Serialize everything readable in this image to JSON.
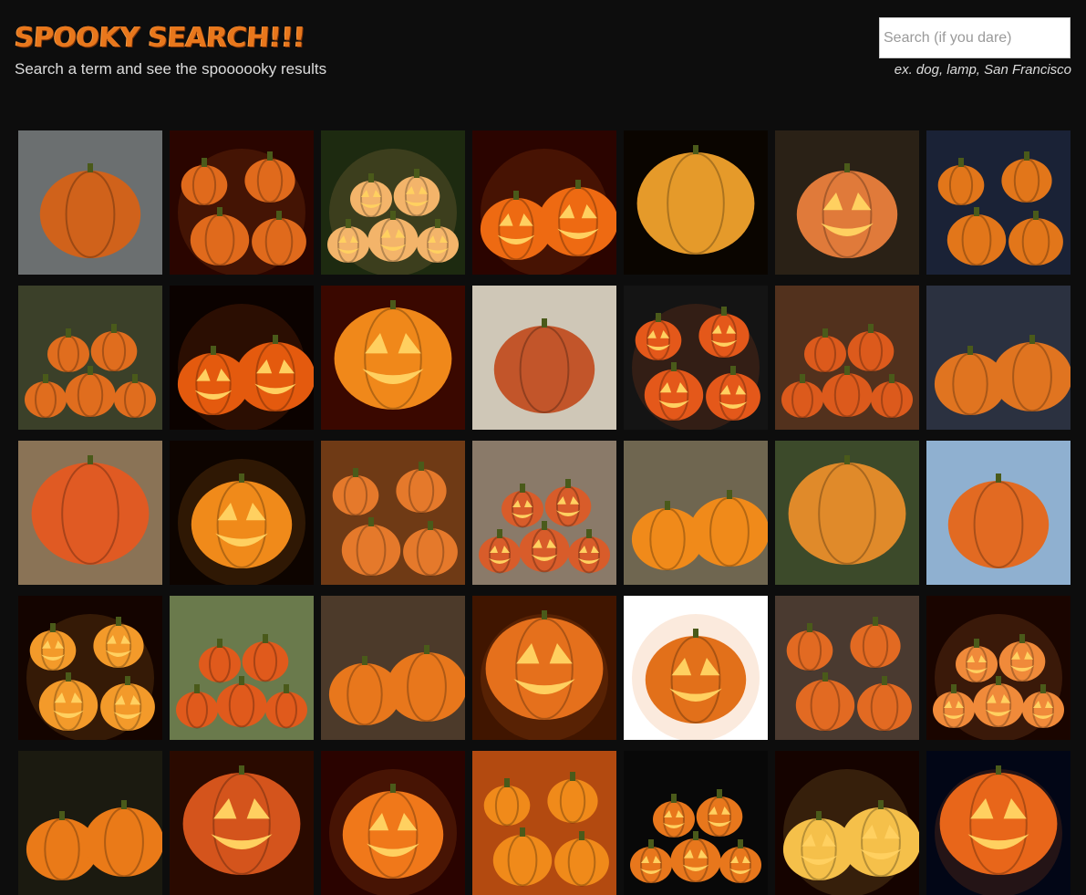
{
  "header": {
    "title": "SPOOKY SEARCH!!!",
    "subtitle": "Search a term and see the spoooooky results"
  },
  "search": {
    "placeholder": "Search (if you dare)",
    "value": "",
    "hint": "ex. dog, lamp, San Francisco"
  },
  "colors": {
    "accent": "#e8771c",
    "background": "#0d0d0d",
    "text": "#dcdcdc"
  },
  "results": [
    {
      "theme": "pumpkins-misty",
      "bg": "#6b6f70",
      "fg": "#d0621b"
    },
    {
      "theme": "pumpkins-dark-red",
      "bg": "#2a0500",
      "fg": "#e06a1c"
    },
    {
      "theme": "jack-o-lantern-pair",
      "bg": "#1d2a10",
      "fg": "#f3b46a"
    },
    {
      "theme": "jack-o-lantern-glow",
      "bg": "#2b0400",
      "fg": "#ee6a12"
    },
    {
      "theme": "small-pumpkins",
      "bg": "#0a0500",
      "fg": "#e59a2a"
    },
    {
      "theme": "carved-flag-pumpkin",
      "bg": "#2a2116",
      "fg": "#e07a3a"
    },
    {
      "theme": "skeleton-pumpkins",
      "bg": "#1a2236",
      "fg": "#e2761a"
    },
    {
      "theme": "pumpkins-pots",
      "bg": "#3b4029",
      "fg": "#e06d1e"
    },
    {
      "theme": "dark-lanterns",
      "bg": "#0b0200",
      "fg": "#e45a0e"
    },
    {
      "theme": "cat-carved-pumpkin",
      "bg": "#3a0800",
      "fg": "#f0881a"
    },
    {
      "theme": "pumpkins-white",
      "bg": "#cfc7b7",
      "fg": "#c2552a"
    },
    {
      "theme": "smiling-lantern",
      "bg": "#141414",
      "fg": "#e4581a"
    },
    {
      "theme": "pumpkin-field-orange",
      "bg": "#52311d",
      "fg": "#dc5a1c"
    },
    {
      "theme": "ghost-pumpkins",
      "bg": "#2b3140",
      "fg": "#e07420"
    },
    {
      "theme": "pumpkin-rows",
      "bg": "#8a7356",
      "fg": "#e05a23"
    },
    {
      "theme": "night-lanterns",
      "bg": "#0d0400",
      "fg": "#f08a1a"
    },
    {
      "theme": "pumpkin-pile",
      "bg": "#6f3a15",
      "fg": "#e5792b"
    },
    {
      "theme": "pumpkin-faces",
      "bg": "#8a7a69",
      "fg": "#d85c2a"
    },
    {
      "theme": "hay-bale-pumpkins",
      "bg": "#6f6650",
      "fg": "#f08a1a"
    },
    {
      "theme": "pumpkin-heap",
      "bg": "#3c4a2a",
      "fg": "#e08a2a"
    },
    {
      "theme": "pumpkin-patch-sign",
      "bg": "#8fb0d0",
      "fg": "#e26a22"
    },
    {
      "theme": "lantern-closeup",
      "bg": "#140400",
      "fg": "#f39a2a"
    },
    {
      "theme": "pumpkin-field",
      "bg": "#6a7a4c",
      "fg": "#e05a1c"
    },
    {
      "theme": "kids-barn",
      "bg": "#4c3a2a",
      "fg": "#e8771c"
    },
    {
      "theme": "cat-lantern",
      "bg": "#401500",
      "fg": "#e5701c"
    },
    {
      "theme": "bat-lantern",
      "bg": "#ffffff",
      "fg": "#e2701a"
    },
    {
      "theme": "child-pumpkins",
      "bg": "#4a3a30",
      "fg": "#e26a22"
    },
    {
      "theme": "glowing-lanterns",
      "bg": "#1a0500",
      "fg": "#f08a3a"
    },
    {
      "theme": "pumpkins-stack",
      "bg": "#1b1a10",
      "fg": "#ea7a18"
    },
    {
      "theme": "carved-faces",
      "bg": "#2a0a00",
      "fg": "#d4541c"
    },
    {
      "theme": "happy-lanterns",
      "bg": "#2a0300",
      "fg": "#f0781a"
    },
    {
      "theme": "pumpkin-bunch",
      "bg": "#b34a10",
      "fg": "#f08a1a"
    },
    {
      "theme": "pumpkin-cake",
      "bg": "#080808",
      "fg": "#e8771c"
    },
    {
      "theme": "face-lantern",
      "bg": "#150300",
      "fg": "#f5c04a"
    },
    {
      "theme": "halloween-neon",
      "bg": "#020616",
      "fg": "#e8661a"
    }
  ]
}
